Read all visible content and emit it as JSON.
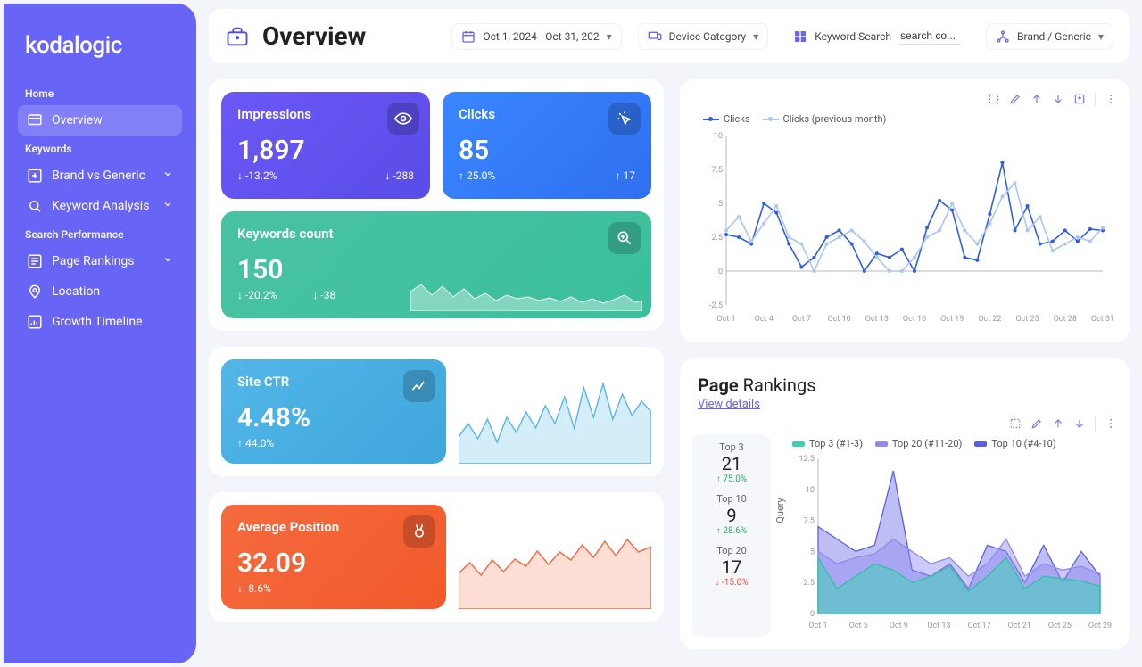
{
  "brand": "kodalogic",
  "nav": {
    "section_home": "Home",
    "overview": "Overview",
    "section_keywords": "Keywords",
    "brand_generic": "Brand vs Generic",
    "keyword_analysis": "Keyword Analysis",
    "section_search_perf": "Search Performance",
    "page_rankings": "Page Rankings",
    "location": "Location",
    "growth_timeline": "Growth Timeline"
  },
  "page_title": "Overview",
  "filters": {
    "date_range": "Oct 1, 2024 - Oct 31, 202",
    "device_label": "Device Category",
    "keyword_label": "Keyword Search",
    "keyword_input": "search co...",
    "brand_label": "Brand / Generic"
  },
  "cards": {
    "impressions": {
      "title": "Impressions",
      "value": "1,897",
      "pct": "-13.2%",
      "abs": "-288"
    },
    "clicks": {
      "title": "Clicks",
      "value": "85",
      "pct": "25.0%",
      "abs": "17"
    },
    "keywords": {
      "title": "Keywords count",
      "value": "150",
      "pct": "-20.2%",
      "abs": "-38"
    },
    "ctr": {
      "title": "Site CTR",
      "value": "4.48%",
      "pct": "44.0%"
    },
    "position": {
      "title": "Average Position",
      "value": "32.09",
      "pct": "-8.6%"
    }
  },
  "clicks_chart": {
    "legend_current": "Clicks",
    "legend_prev": "Clicks (previous month)",
    "y_ticks": [
      "-2.5",
      "0",
      "2.5",
      "5",
      "7.5",
      "10"
    ],
    "x_ticks": [
      "Oct 1",
      "Oct 4",
      "Oct 7",
      "Oct 10",
      "Oct 13",
      "Oct 16",
      "Oct 19",
      "Oct 22",
      "Oct 25",
      "Oct 28",
      "Oct 31"
    ]
  },
  "rankings": {
    "title_strong": "Page",
    "title_rest": " Rankings",
    "view_details": "View details",
    "y_label": "Query",
    "legend": {
      "top3": "Top 3 (#1-3)",
      "top20": "Top 20 (#11-20)",
      "top10": "Top 10 (#4-10)"
    },
    "stats": {
      "top3": {
        "label": "Top 3",
        "value": "21",
        "delta": "75.0%",
        "dir": "up"
      },
      "top10": {
        "label": "Top 10",
        "value": "9",
        "delta": "28.6%",
        "dir": "up"
      },
      "top20": {
        "label": "Top 20",
        "value": "17",
        "delta": "-15.0%",
        "dir": "down"
      }
    },
    "y_ticks": [
      "0",
      "2.5",
      "5",
      "7.5",
      "10",
      "12.5"
    ],
    "x_ticks": [
      "Oct 1",
      "Oct 5",
      "Oct 9",
      "Oct 13",
      "Oct 17",
      "Oct 21",
      "Oct 25",
      "Oct 29"
    ]
  },
  "chart_data": [
    {
      "type": "line",
      "title": "Clicks vs Clicks (previous month)",
      "xlabel": "",
      "ylabel": "",
      "ylim": [
        -2.5,
        10
      ],
      "x": [
        "Oct 1",
        "Oct 2",
        "Oct 3",
        "Oct 4",
        "Oct 5",
        "Oct 6",
        "Oct 7",
        "Oct 8",
        "Oct 9",
        "Oct 10",
        "Oct 11",
        "Oct 12",
        "Oct 13",
        "Oct 14",
        "Oct 15",
        "Oct 16",
        "Oct 17",
        "Oct 18",
        "Oct 19",
        "Oct 20",
        "Oct 21",
        "Oct 22",
        "Oct 23",
        "Oct 24",
        "Oct 25",
        "Oct 26",
        "Oct 27",
        "Oct 28",
        "Oct 29",
        "Oct 30",
        "Oct 31"
      ],
      "series": [
        {
          "name": "Clicks",
          "values": [
            2.7,
            2.5,
            2.0,
            5.0,
            4.3,
            2.0,
            0.3,
            1.0,
            2.5,
            3.0,
            2.0,
            0.0,
            1.3,
            1.0,
            1.6,
            0.0,
            3.2,
            5.2,
            4.5,
            1.0,
            0.8,
            4.2,
            8.0,
            3.0,
            4.8,
            2.0,
            2.2,
            3.0,
            2.2,
            3.1,
            3.0
          ]
        },
        {
          "name": "Clicks (previous month)",
          "values": [
            3.0,
            4.0,
            2.2,
            3.5,
            4.8,
            2.5,
            2.0,
            0.0,
            2.0,
            2.5,
            3.0,
            2.2,
            1.0,
            0.0,
            0.0,
            1.0,
            2.5,
            3.0,
            5.0,
            3.0,
            2.0,
            3.5,
            5.5,
            6.5,
            3.0,
            4.0,
            1.5,
            2.0,
            2.5,
            2.2,
            3.2
          ]
        }
      ]
    },
    {
      "type": "area",
      "title": "Page Rankings",
      "xlabel": "",
      "ylabel": "Query",
      "ylim": [
        0,
        12.5
      ],
      "x": [
        "Oct 1",
        "Oct 3",
        "Oct 5",
        "Oct 7",
        "Oct 9",
        "Oct 11",
        "Oct 13",
        "Oct 15",
        "Oct 17",
        "Oct 19",
        "Oct 21",
        "Oct 23",
        "Oct 25",
        "Oct 27",
        "Oct 29",
        "Oct 31"
      ],
      "series": [
        {
          "name": "Top 3 (#1-3)",
          "values": [
            4.5,
            2.0,
            3.0,
            4.0,
            3.5,
            2.5,
            3.0,
            3.8,
            1.8,
            3.0,
            4.5,
            2.0,
            3.0,
            2.8,
            2.6,
            2.2
          ]
        },
        {
          "name": "Top 10 (#4-10)",
          "values": [
            7.0,
            6.0,
            5.0,
            5.5,
            11.5,
            3.5,
            3.0,
            4.0,
            2.0,
            5.5,
            5.0,
            2.5,
            5.5,
            2.5,
            5.0,
            3.0
          ]
        },
        {
          "name": "Top 20 (#11-20)",
          "values": [
            5.0,
            4.0,
            4.5,
            4.8,
            6.0,
            5.0,
            4.0,
            4.5,
            3.0,
            4.0,
            6.0,
            3.0,
            4.0,
            3.5,
            3.8,
            3.2
          ]
        }
      ]
    }
  ]
}
